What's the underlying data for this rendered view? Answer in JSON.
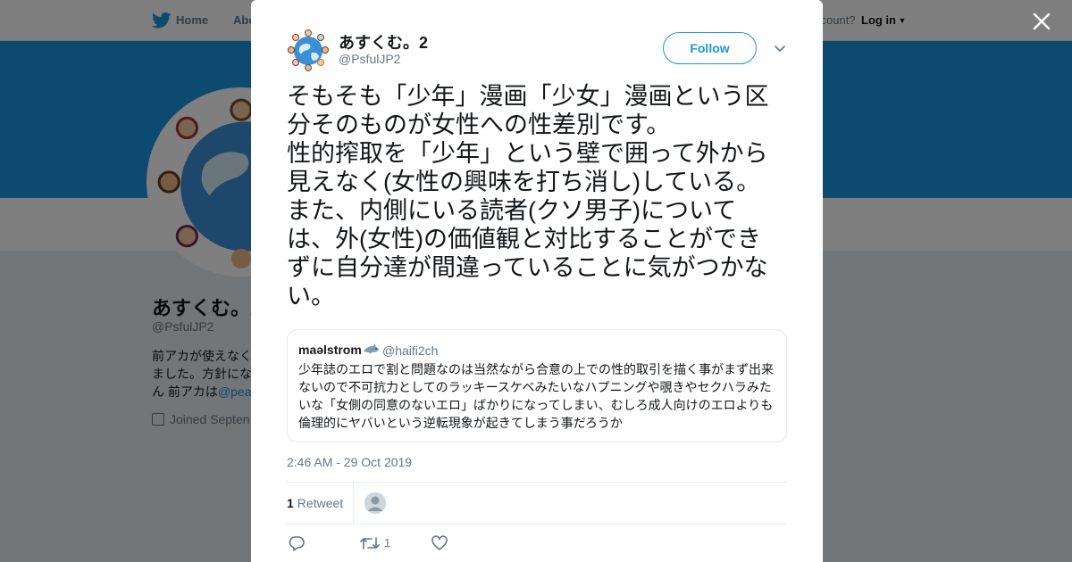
{
  "topbar": {
    "home_label": "Home",
    "about_label": "Abo",
    "account_prompt": "ccount?",
    "login_label": "Log in"
  },
  "profile_bg": {
    "name": "あすくむ。2",
    "handle": "@PsfulJP2",
    "bio_line1": "前アカが使えなく",
    "bio_line2": "ました。方針にな",
    "bio_line3": "ん 前アカは",
    "bio_link": "@pea",
    "joined": "Joined Septen"
  },
  "tweet": {
    "author_name": "あすくむ。2",
    "author_handle": "@PsfulJP2",
    "follow_label": "Follow",
    "text_lines": [
      "そもそも「少年」漫画「少女」漫画という区",
      "分そのものが女性への性差別です。",
      "性的搾取を「少年」という壁で囲って外から",
      "見えなく(女性の興味を打ち消し)している。",
      "また、内側にいる読者(クソ男子)について",
      "は、外(女性)の価値観と対比することができ",
      "ずに自分達が間違っていることに気がつかな",
      "い。"
    ],
    "timestamp": "2:46 AM - 29 Oct 2019",
    "retweet_count": "1",
    "retweet_label": "Retweet",
    "action_retweet_count": "1"
  },
  "quote": {
    "name": "maəlstrom",
    "handle": "@haifi2ch",
    "text_lines": [
      "少年誌のエロで割と問題なのは当然ながら合意の上での性的取引を描く事がまず出来",
      "ないので不可抗力としてのラッキースケベみたいなハプニングや覗きやセクハラみた",
      "いな「女側の同意のないエロ」ばかりになってしまい、むしろ成人向けのエロよりも",
      "倫理的にヤバいという逆転現象が起きてしまう事だろうか"
    ]
  },
  "icons": {
    "bird": "twitter-bird-icon",
    "close": "close-icon",
    "caret": "chevron-down-icon",
    "reply": "reply-icon",
    "retweet": "retweet-icon",
    "like": "heart-icon",
    "calendar": "calendar-icon",
    "shark": "shark-emoji-icon"
  },
  "colors": {
    "accent": "#1b95e0",
    "banner": "#1b95e0",
    "secondary_text": "#657786",
    "primary_text": "#14171a"
  }
}
